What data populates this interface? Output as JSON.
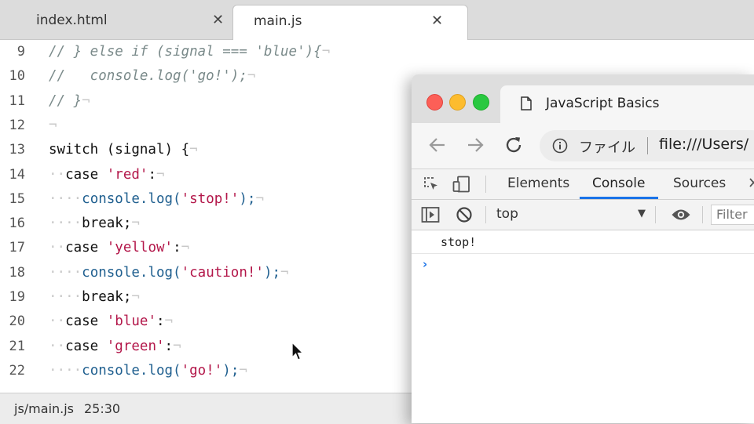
{
  "editor": {
    "tabs": [
      {
        "label": "index.html",
        "close": "✕"
      },
      {
        "label": "main.js",
        "close": "✕"
      }
    ],
    "lines": [
      {
        "num": "9",
        "tokens": [
          {
            "c": "cm",
            "t": "// } else if (signal === 'blue'){"
          },
          {
            "c": "inv",
            "t": "¬"
          }
        ]
      },
      {
        "num": "10",
        "tokens": [
          {
            "c": "cm",
            "t": "//   console.log('go!');"
          },
          {
            "c": "inv",
            "t": "¬"
          }
        ]
      },
      {
        "num": "11",
        "tokens": [
          {
            "c": "cm",
            "t": "// }"
          },
          {
            "c": "inv",
            "t": "¬"
          }
        ]
      },
      {
        "num": "12",
        "tokens": [
          {
            "c": "inv",
            "t": "¬"
          }
        ]
      },
      {
        "num": "13",
        "tokens": [
          {
            "c": "kw",
            "t": "switch"
          },
          {
            "c": "kw",
            "t": " (signal) {"
          },
          {
            "c": "inv",
            "t": "¬"
          }
        ]
      },
      {
        "num": "14",
        "tokens": [
          {
            "c": "inv",
            "t": "··"
          },
          {
            "c": "kw",
            "t": "case "
          },
          {
            "c": "str",
            "t": "'red'"
          },
          {
            "c": "kw",
            "t": ":"
          },
          {
            "c": "inv",
            "t": "¬"
          }
        ]
      },
      {
        "num": "15",
        "tokens": [
          {
            "c": "inv",
            "t": "····"
          },
          {
            "c": "fn",
            "t": "console.log("
          },
          {
            "c": "str",
            "t": "'stop!'"
          },
          {
            "c": "fn",
            "t": ");"
          },
          {
            "c": "inv",
            "t": "¬"
          }
        ]
      },
      {
        "num": "16",
        "tokens": [
          {
            "c": "inv",
            "t": "····"
          },
          {
            "c": "kw",
            "t": "break;"
          },
          {
            "c": "inv",
            "t": "¬"
          }
        ]
      },
      {
        "num": "17",
        "tokens": [
          {
            "c": "inv",
            "t": "··"
          },
          {
            "c": "kw",
            "t": "case "
          },
          {
            "c": "str",
            "t": "'yellow'"
          },
          {
            "c": "kw",
            "t": ":"
          },
          {
            "c": "inv",
            "t": "¬"
          }
        ]
      },
      {
        "num": "18",
        "tokens": [
          {
            "c": "inv",
            "t": "····"
          },
          {
            "c": "fn",
            "t": "console.log("
          },
          {
            "c": "str",
            "t": "'caution!'"
          },
          {
            "c": "fn",
            "t": ");"
          },
          {
            "c": "inv",
            "t": "¬"
          }
        ]
      },
      {
        "num": "19",
        "tokens": [
          {
            "c": "inv",
            "t": "····"
          },
          {
            "c": "kw",
            "t": "break;"
          },
          {
            "c": "inv",
            "t": "¬"
          }
        ]
      },
      {
        "num": "20",
        "tokens": [
          {
            "c": "inv",
            "t": "··"
          },
          {
            "c": "kw",
            "t": "case "
          },
          {
            "c": "str",
            "t": "'blue'"
          },
          {
            "c": "kw",
            "t": ":"
          },
          {
            "c": "inv",
            "t": "¬"
          }
        ]
      },
      {
        "num": "21",
        "tokens": [
          {
            "c": "inv",
            "t": "··"
          },
          {
            "c": "kw",
            "t": "case "
          },
          {
            "c": "str",
            "t": "'green'"
          },
          {
            "c": "kw",
            "t": ":"
          },
          {
            "c": "inv",
            "t": "¬"
          }
        ]
      },
      {
        "num": "22",
        "tokens": [
          {
            "c": "inv",
            "t": "····"
          },
          {
            "c": "fn",
            "t": "console.log("
          },
          {
            "c": "str",
            "t": "'go!'"
          },
          {
            "c": "fn",
            "t": ");"
          },
          {
            "c": "inv",
            "t": "¬"
          }
        ]
      }
    ],
    "status": {
      "file": "js/main.js",
      "position": "25:30"
    }
  },
  "browser": {
    "tab_title": "JavaScript Basics",
    "omnibox": {
      "security_label": "ファイル",
      "url": "file:///Users/"
    },
    "devtools": {
      "tabs": [
        "Elements",
        "Console",
        "Sources"
      ],
      "active_tab": "Console",
      "context": "top",
      "filter_placeholder": "Filter"
    },
    "console": {
      "messages": [
        "stop!"
      ],
      "prompt": "›"
    }
  },
  "colors": {
    "string": "#b3174a",
    "function": "#1f5f8f",
    "comment": "#7a8a8a",
    "accent": "#1a73e8"
  }
}
